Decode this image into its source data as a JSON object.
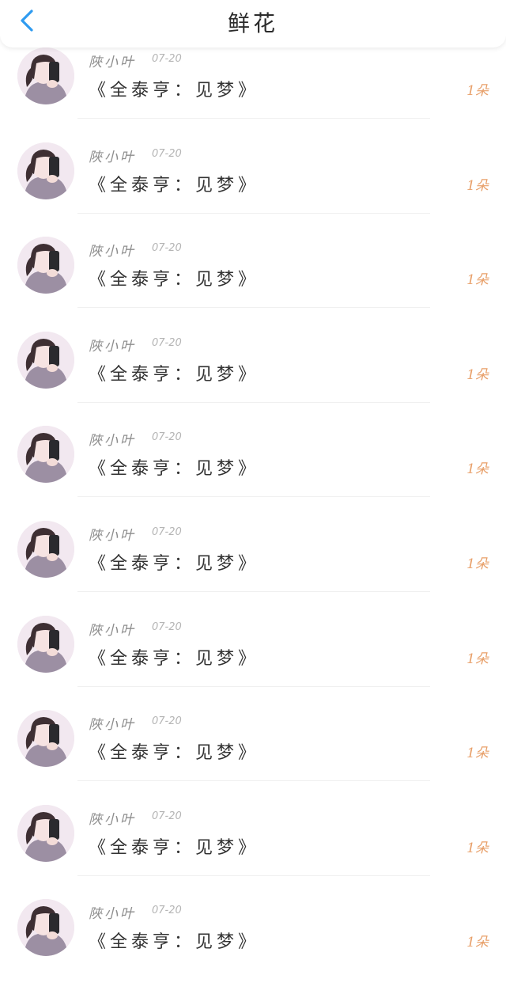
{
  "header": {
    "title": "鲜花",
    "back_icon": "chevron-left-icon",
    "accent_color": "#2f9bf0"
  },
  "colors": {
    "count": "#e8a06a",
    "name": "#8e8e8e",
    "date": "#b5b5b5",
    "text": "#333333"
  },
  "items": [
    {
      "name": "陜小叶",
      "date": "07-20",
      "work": "《全泰亨：见梦》",
      "count": "1朵"
    },
    {
      "name": "陜小叶",
      "date": "07-20",
      "work": "《全泰亨：见梦》",
      "count": "1朵"
    },
    {
      "name": "陜小叶",
      "date": "07-20",
      "work": "《全泰亨：见梦》",
      "count": "1朵"
    },
    {
      "name": "陜小叶",
      "date": "07-20",
      "work": "《全泰亨：见梦》",
      "count": "1朵"
    },
    {
      "name": "陜小叶",
      "date": "07-20",
      "work": "《全泰亨：见梦》",
      "count": "1朵"
    },
    {
      "name": "陜小叶",
      "date": "07-20",
      "work": "《全泰亨：见梦》",
      "count": "1朵"
    },
    {
      "name": "陜小叶",
      "date": "07-20",
      "work": "《全泰亨：见梦》",
      "count": "1朵"
    },
    {
      "name": "陜小叶",
      "date": "07-20",
      "work": "《全泰亨：见梦》",
      "count": "1朵"
    },
    {
      "name": "陜小叶",
      "date": "07-20",
      "work": "《全泰亨：见梦》",
      "count": "1朵"
    },
    {
      "name": "陜小叶",
      "date": "07-20",
      "work": "《全泰亨：见梦》",
      "count": "1朵"
    }
  ]
}
